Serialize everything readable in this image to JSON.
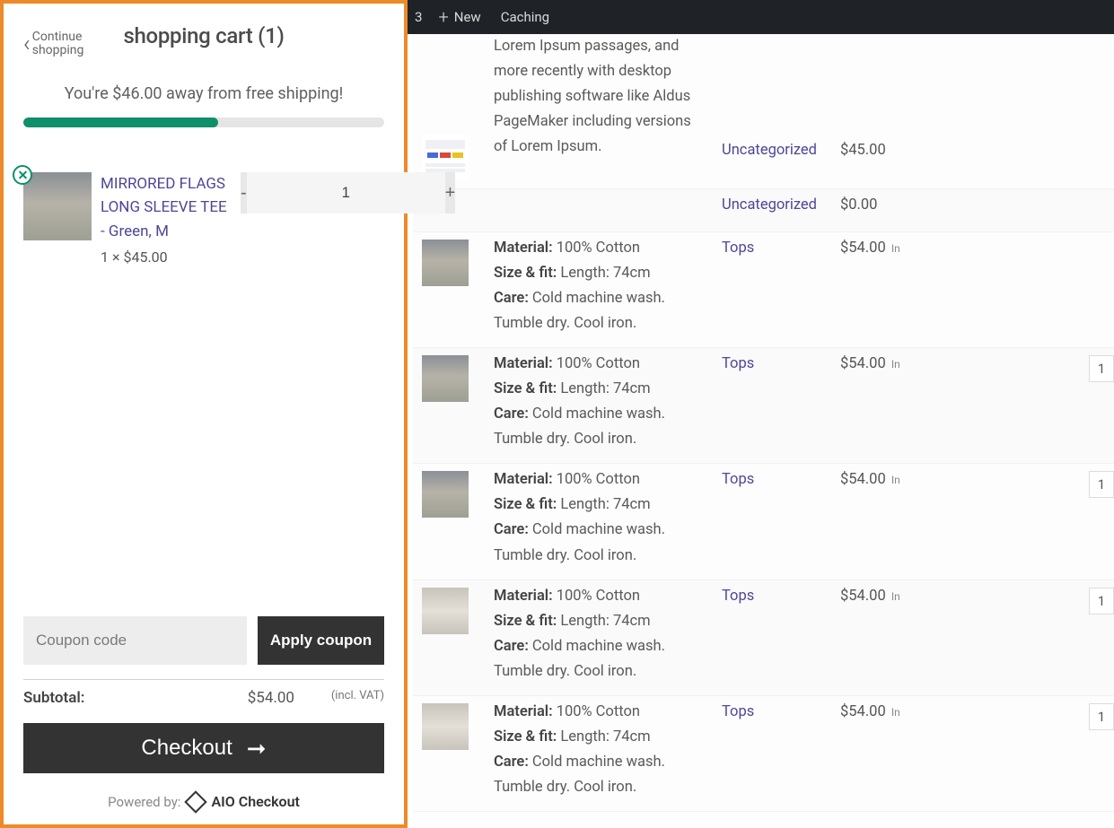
{
  "admin_bar": {
    "count": "3",
    "new_label": "New",
    "caching_label": "Caching"
  },
  "background": {
    "intro_text": "Lorem Ipsum passages, and more recently with desktop publishing software like Aldus PageMaker including versions of Lorem Ipsum.",
    "rows": [
      {
        "type": "intro",
        "category": "Uncategorized",
        "price": "$45.00",
        "in": ""
      },
      {
        "type": "plain",
        "category": "Uncategorized",
        "price": "$0.00",
        "in": ""
      },
      {
        "type": "product",
        "thumb": "model",
        "material_label": "Material:",
        "material": "100% Cotton",
        "size_label": "Size & fit:",
        "size": "Length: 74cm",
        "care_label": "Care:",
        "care": "Cold machine wash. Tumble dry. Cool iron.",
        "category": "Tops",
        "price": "$54.00",
        "in": "In",
        "badge": ""
      },
      {
        "type": "product",
        "thumb": "model",
        "material_label": "Material:",
        "material": "100% Cotton",
        "size_label": "Size & fit:",
        "size": "Length: 74cm",
        "care_label": "Care:",
        "care": "Cold machine wash. Tumble dry. Cool iron.",
        "category": "Tops",
        "price": "$54.00",
        "in": "In",
        "badge": "1"
      },
      {
        "type": "product",
        "thumb": "model",
        "material_label": "Material:",
        "material": "100% Cotton",
        "size_label": "Size & fit:",
        "size": "Length: 74cm",
        "care_label": "Care:",
        "care": "Cold machine wash. Tumble dry. Cool iron.",
        "category": "Tops",
        "price": "$54.00",
        "in": "In",
        "badge": "1"
      },
      {
        "type": "product",
        "thumb": "model2",
        "material_label": "Material:",
        "material": "100% Cotton",
        "size_label": "Size & fit:",
        "size": "Length: 74cm",
        "care_label": "Care:",
        "care": "Cold machine wash. Tumble dry. Cool iron.",
        "category": "Tops",
        "price": "$54.00",
        "in": "In",
        "badge": "1"
      },
      {
        "type": "product",
        "thumb": "model2",
        "material_label": "Material:",
        "material": "100% Cotton",
        "size_label": "Size & fit:",
        "size": "Length: 74cm",
        "care_label": "Care:",
        "care": "Cold machine wash. Tumble dry. Cool iron.",
        "category": "Tops",
        "price": "$54.00",
        "in": "In",
        "badge": "1"
      }
    ]
  },
  "cart": {
    "continue_label_1": "Continue",
    "continue_label_2": "shopping",
    "title": "shopping cart (1)",
    "shipping_msg": "You're $46.00 away from free shipping!",
    "progress_percent": 54,
    "item": {
      "name": "MIRRORED FLAGS LONG SLEEVE TEE - Green, M",
      "qty_price": "1 × $45.00",
      "qty": "1"
    },
    "coupon_placeholder": "Coupon code",
    "apply_label": "Apply coupon",
    "subtotal_label": "Subtotal:",
    "subtotal_value": "$54.00",
    "vat_label": "(incl. VAT)",
    "checkout_label": "Checkout",
    "powered_prefix": "Powered by:",
    "powered_brand": "AIO Checkout"
  }
}
